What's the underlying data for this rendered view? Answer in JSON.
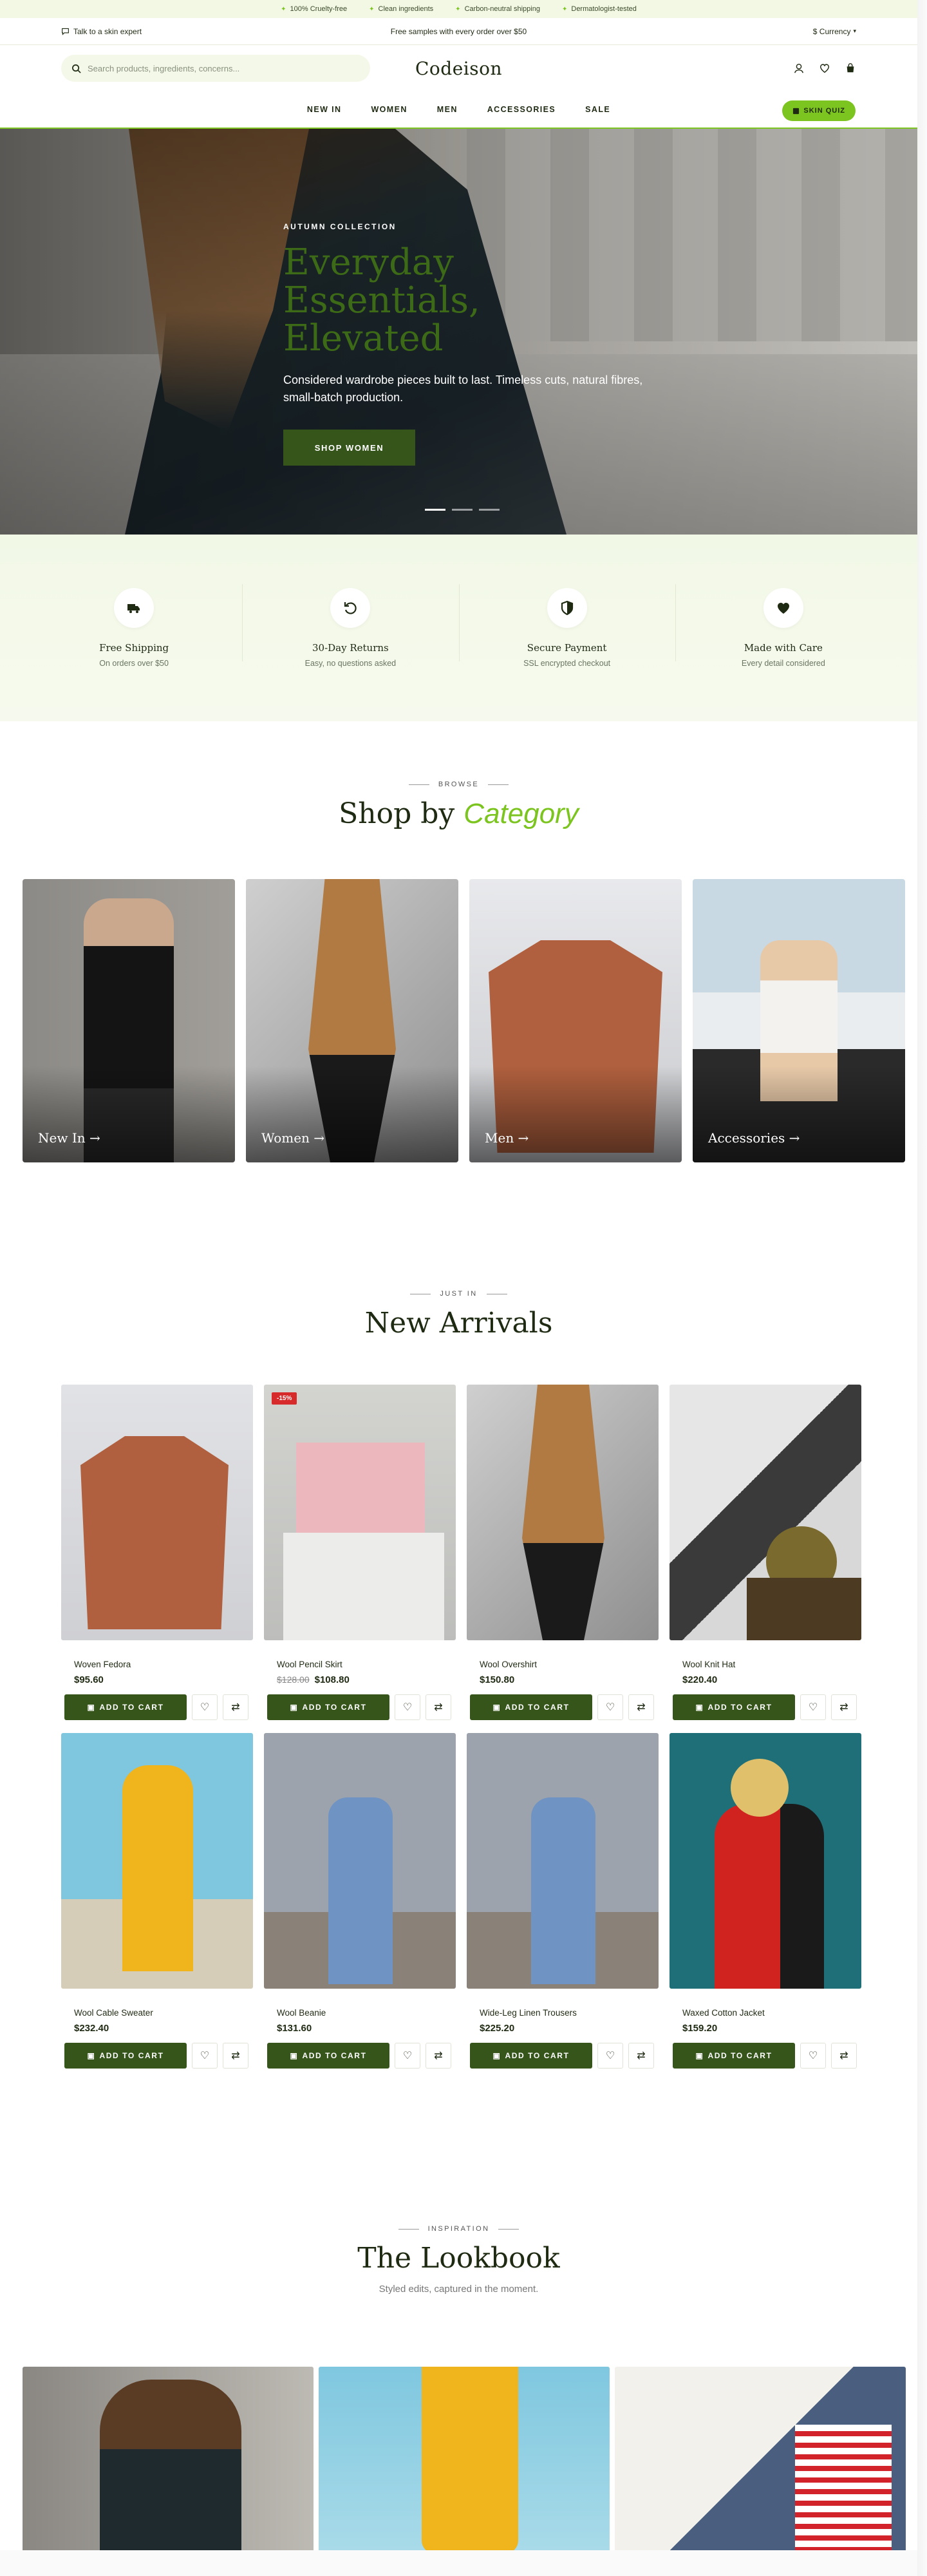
{
  "announcement": {
    "items": [
      "100% Cruelty-free",
      "Clean ingredients",
      "Carbon-neutral shipping",
      "Dermatologist-tested"
    ]
  },
  "utility": {
    "expert": "Talk to a skin expert",
    "promo": "Free samples with every order over $50",
    "currency": "$ Currency"
  },
  "header": {
    "search_placeholder": "Search products, ingredients, concerns...",
    "logo": "Codeison",
    "quiz": "SKIN QUIZ"
  },
  "nav": {
    "items": [
      "NEW IN",
      "WOMEN",
      "MEN",
      "ACCESSORIES",
      "SALE"
    ]
  },
  "hero": {
    "kicker": "AUTUMN COLLECTION",
    "title": "Everyday Essentials, Elevated",
    "text": "Considered wardrobe pieces built to last. Timeless cuts, natural fibres, small-batch production.",
    "cta": "SHOP WOMEN"
  },
  "features": [
    {
      "icon": "truck-icon",
      "title": "Free Shipping",
      "sub": "On orders over $50"
    },
    {
      "icon": "return-icon",
      "title": "30-Day Returns",
      "sub": "Easy, no questions asked"
    },
    {
      "icon": "shield-icon",
      "title": "Secure Payment",
      "sub": "SSL encrypted checkout"
    },
    {
      "icon": "heart-icon",
      "title": "Made with Care",
      "sub": "Every detail considered"
    }
  ],
  "categories": {
    "eyebrow": "BROWSE",
    "title_a": "Shop by",
    "title_b": "Category",
    "items": [
      "New In →",
      "Women →",
      "Men →",
      "Accessories →"
    ]
  },
  "arrivals": {
    "eyebrow": "JUST IN",
    "title": "New Arrivals",
    "cart_label": "ADD TO CART",
    "products": [
      {
        "name": "Woven Fedora",
        "price": "$95.60",
        "old": "",
        "badge": ""
      },
      {
        "name": "Wool Pencil Skirt",
        "price": "$108.80",
        "old": "$128.00",
        "badge": "-15%"
      },
      {
        "name": "Wool Overshirt",
        "price": "$150.80",
        "old": "",
        "badge": ""
      },
      {
        "name": "Wool Knit Hat",
        "price": "$220.40",
        "old": "",
        "badge": ""
      },
      {
        "name": "Wool Cable Sweater",
        "price": "$232.40",
        "old": "",
        "badge": ""
      },
      {
        "name": "Wool Beanie",
        "price": "$131.60",
        "old": "",
        "badge": ""
      },
      {
        "name": "Wide-Leg Linen Trousers",
        "price": "$225.20",
        "old": "",
        "badge": ""
      },
      {
        "name": "Waxed Cotton Jacket",
        "price": "$159.20",
        "old": "",
        "badge": ""
      }
    ]
  },
  "lookbook": {
    "eyebrow": "INSPIRATION",
    "title": "The Lookbook",
    "sub": "Styled edits, captured in the moment."
  },
  "colors": {
    "accent": "#7cc41f",
    "dark_green": "#35551a",
    "sale": "#d72b2b"
  }
}
